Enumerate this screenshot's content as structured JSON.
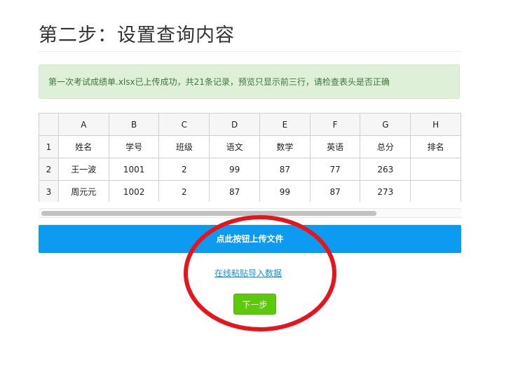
{
  "page": {
    "title": "第二步：设置查询内容"
  },
  "alert": {
    "message": "第一次考试成绩单.xlsx已上传成功，共21条记录，预览只显示前三行，请检查表头是否正确"
  },
  "sheet": {
    "columns": [
      "A",
      "B",
      "C",
      "D",
      "E",
      "F",
      "G",
      "H"
    ],
    "rows": [
      {
        "num": "1",
        "cells": [
          "姓名",
          "学号",
          "班级",
          "语文",
          "数学",
          "英语",
          "总分",
          "排名"
        ]
      },
      {
        "num": "2",
        "cells": [
          "王一波",
          "1001",
          "2",
          "99",
          "87",
          "77",
          "263",
          ""
        ]
      },
      {
        "num": "3",
        "cells": [
          "周元元",
          "1002",
          "2",
          "87",
          "99",
          "87",
          "273",
          ""
        ]
      }
    ]
  },
  "buttons": {
    "upload_label": "点此按钮上传文件",
    "paste_label": "在线粘贴导入数据",
    "next_label": "下一步"
  },
  "colors": {
    "upload": "#0d9bf2",
    "next": "#5cc90a",
    "annotation": "#e8141b"
  }
}
